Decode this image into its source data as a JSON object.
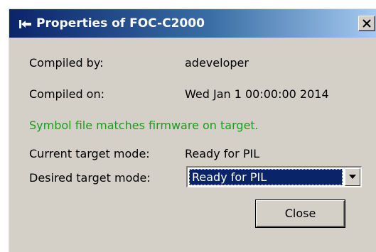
{
  "window": {
    "title": "Properties of FOC-C2000",
    "title_icon": "pin-icon",
    "close_glyph": "×"
  },
  "properties": {
    "compiled_by_label": "Compiled by:",
    "compiled_by_value": "adeveloper",
    "compiled_on_label": "Compiled on:",
    "compiled_on_value": "Wed Jan 1 00:00:00 2014",
    "status_message": "Symbol file matches firmware on target.",
    "current_mode_label": "Current target mode:",
    "current_mode_value": "Ready for PIL",
    "desired_mode_label": "Desired target mode:",
    "desired_mode_selected": "Ready for PIL"
  },
  "buttons": {
    "close_label": "Close"
  },
  "colors": {
    "title_bar_start": "#0a246a",
    "title_bar_end": "#a6caf0",
    "dialog_face": "#d4d0c8",
    "status_ok": "#1e9a1e",
    "selection": "#0a246a"
  }
}
